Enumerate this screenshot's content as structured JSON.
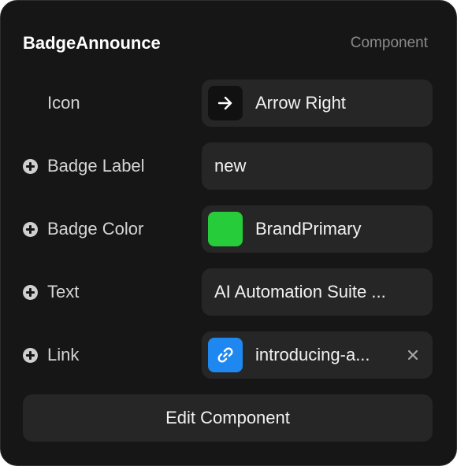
{
  "header": {
    "title": "BadgeAnnounce",
    "kind": "Component"
  },
  "colors": {
    "panel_bg": "#161616",
    "field_bg": "#262626",
    "icon_swatch": "#111111",
    "brand_primary": "#27cc3a",
    "link_blue": "#1e88f0"
  },
  "props": {
    "icon": {
      "label": "Icon",
      "value": "Arrow Right",
      "icon": "arrow-right-icon"
    },
    "badge_label": {
      "label": "Badge Label",
      "value": "new"
    },
    "badge_color": {
      "label": "Badge Color",
      "value": "BrandPrimary"
    },
    "text": {
      "label": "Text",
      "value": "AI Automation Suite ..."
    },
    "link": {
      "label": "Link",
      "value": "introducing-a...",
      "icon": "link-icon"
    }
  },
  "actions": {
    "edit_label": "Edit Component"
  }
}
